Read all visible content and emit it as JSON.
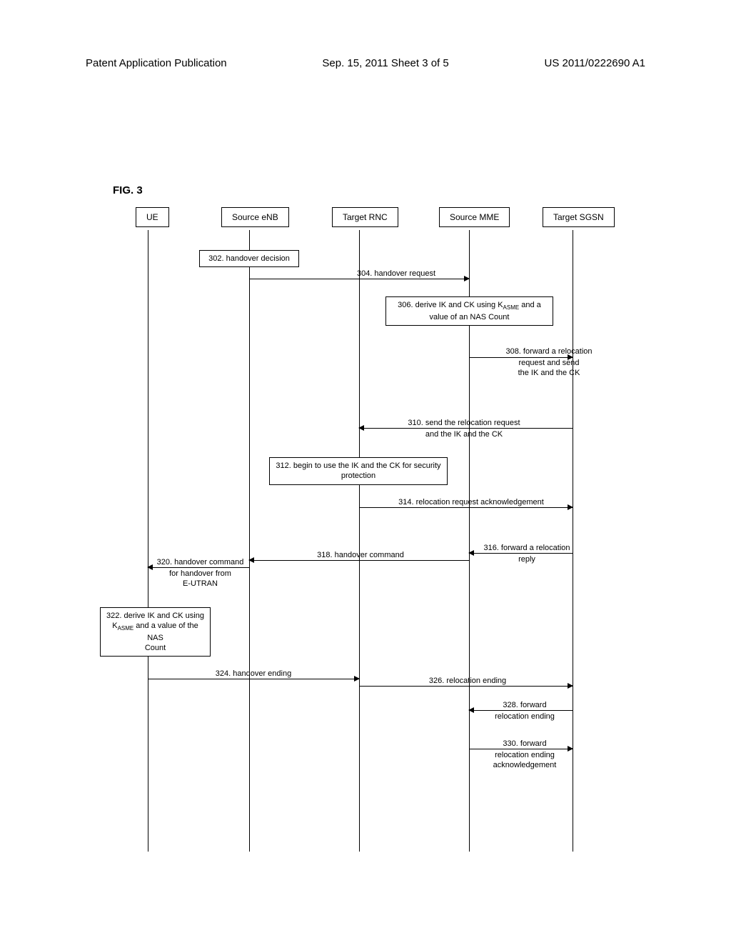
{
  "header": {
    "left": "Patent Application Publication",
    "center": "Sep. 15, 2011  Sheet 3 of 5",
    "right": "US 2011/0222690 A1"
  },
  "figure_label": "FIG. 3",
  "participants": {
    "ue": "UE",
    "source_enb": "Source eNB",
    "target_rnc": "Target RNC",
    "source_mme": "Source MME",
    "target_sgsn": "Target SGSN"
  },
  "messages": {
    "m302": "302. handover decision",
    "m304": "304. handover request",
    "m306_line1": "306. derive IK and CK using K",
    "m306_sub": "ASME",
    "m306_line1b": " and a",
    "m306_line2": "value of an NAS Count",
    "m308_line1": "308. forward a relocation",
    "m308_line2": "request and send",
    "m308_line3": "the IK and the CK",
    "m310_line1": "310. send the relocation request",
    "m310_line2": "and  the IK and the CK",
    "m312_line1": "312. begin to use the IK and the CK for security",
    "m312_line2": "protection",
    "m314": "314. relocation request acknowledgement",
    "m316_line1": "316. forward a relocation",
    "m316_line2": "reply",
    "m318": "318. handover command",
    "m320_line1": "320. handover command",
    "m320_line2": "for handover from",
    "m320_line3": "E-UTRAN",
    "m322_line1": "322. derive IK and CK using",
    "m322_line2a": "K",
    "m322_sub": "ASME",
    "m322_line2b": " and a value of the NAS",
    "m322_line3": "Count",
    "m324": "324. handover ending",
    "m326": "326. relocation ending",
    "m328_line1": "328. forward",
    "m328_line2": "relocation ending",
    "m330_line1": "330. forward",
    "m330_line2": "relocation ending",
    "m330_line3": "acknowledgement"
  }
}
